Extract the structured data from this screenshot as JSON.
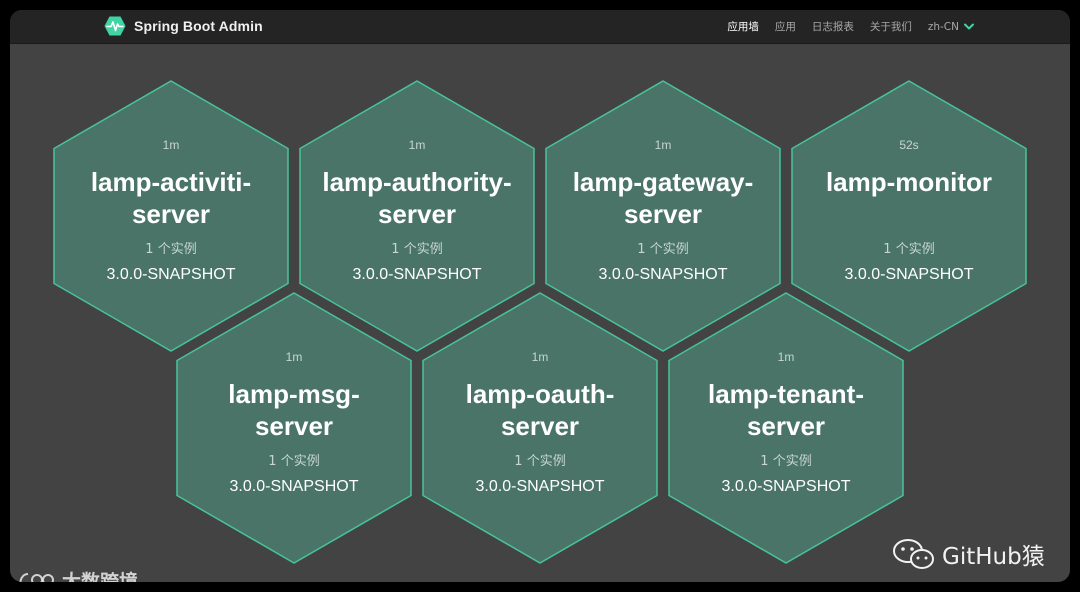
{
  "app": {
    "title": "Spring Boot Admin",
    "accent_color": "#42d3a5"
  },
  "nav": {
    "items": [
      {
        "label": "应用墙",
        "active": true
      },
      {
        "label": "应用",
        "active": false
      },
      {
        "label": "日志报表",
        "active": false
      },
      {
        "label": "关于我们",
        "active": false
      }
    ],
    "language": "zh-CN"
  },
  "hex_style": {
    "fill": "#4a7467",
    "stroke": "#47c49b"
  },
  "applications": [
    {
      "time": "1m",
      "name": "lamp-activiti-server",
      "instances": "1 个实例",
      "version": "3.0.0-SNAPSHOT"
    },
    {
      "time": "1m",
      "name": "lamp-authority-server",
      "instances": "1 个实例",
      "version": "3.0.0-SNAPSHOT"
    },
    {
      "time": "1m",
      "name": "lamp-gateway-server",
      "instances": "1 个实例",
      "version": "3.0.0-SNAPSHOT"
    },
    {
      "time": "52s",
      "name": "lamp-monitor",
      "instances": "1 个实例",
      "version": "3.0.0-SNAPSHOT"
    },
    {
      "time": "1m",
      "name": "lamp-msg-server",
      "instances": "1 个实例",
      "version": "3.0.0-SNAPSHOT"
    },
    {
      "time": "1m",
      "name": "lamp-oauth-server",
      "instances": "1 个实例",
      "version": "3.0.0-SNAPSHOT"
    },
    {
      "time": "1m",
      "name": "lamp-tenant-server",
      "instances": "1 个实例",
      "version": "3.0.0-SNAPSHOT"
    }
  ],
  "watermarks": {
    "left": "大数跨境",
    "right": "GitHub猿"
  }
}
